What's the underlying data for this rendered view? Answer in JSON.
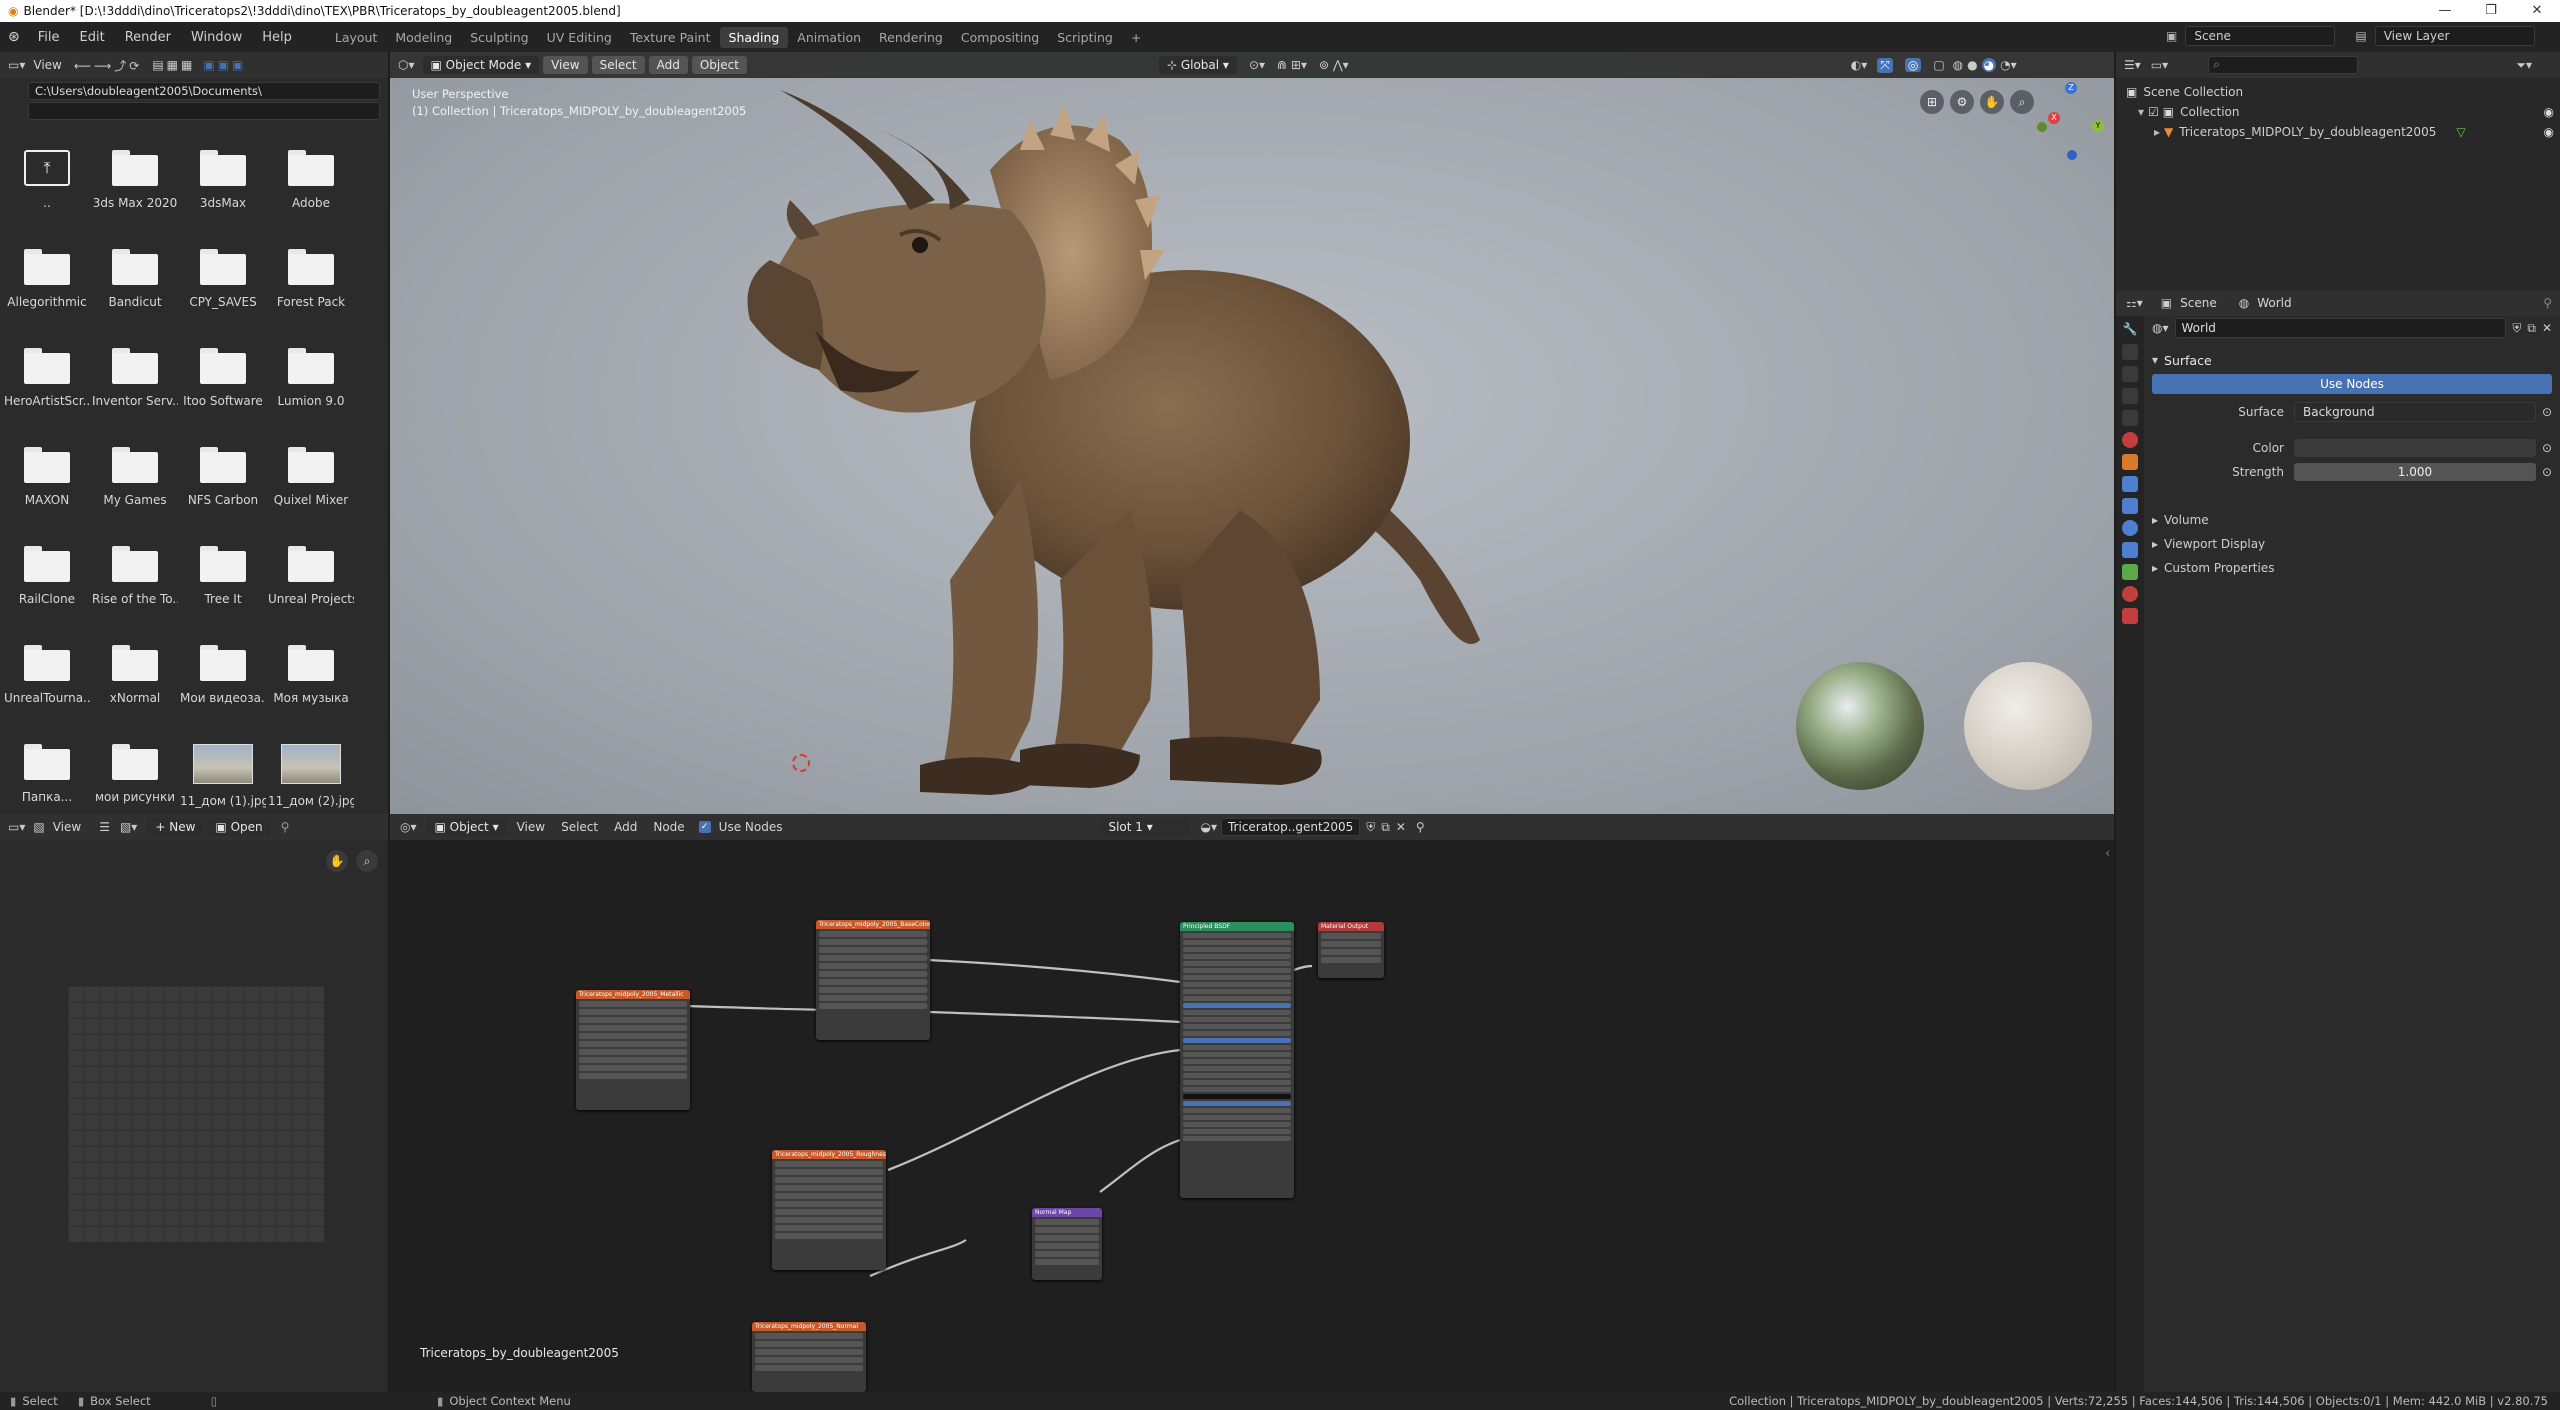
{
  "window": {
    "title": "Blender* [D:\\!3dddi\\dino\\Triceratops2\\!3dddi\\dino\\TEX\\PBR\\Triceratops_by_doubleagent2005.blend]",
    "min": "—",
    "max": "❐",
    "close": "✕"
  },
  "menu": {
    "items": [
      "File",
      "Edit",
      "Render",
      "Window",
      "Help"
    ]
  },
  "workspaces": {
    "tabs": [
      "Layout",
      "Modeling",
      "Sculpting",
      "UV Editing",
      "Texture Paint",
      "Shading",
      "Animation",
      "Rendering",
      "Compositing",
      "Scripting"
    ],
    "active": "Shading",
    "add": "+"
  },
  "scene": {
    "label": "Scene",
    "view_layer": "View Layer"
  },
  "filebrowser": {
    "view": "View",
    "path": "C:\\Users\\doubleagent2005\\Documents\\",
    "items": [
      {
        "label": ".."
      },
      {
        "label": "3ds Max 2020"
      },
      {
        "label": "3dsMax"
      },
      {
        "label": "Adobe"
      },
      {
        "label": "Allegorithmic"
      },
      {
        "label": "Bandicut"
      },
      {
        "label": "CPY_SAVES"
      },
      {
        "label": "Forest Pack"
      },
      {
        "label": "HeroArtistScr..."
      },
      {
        "label": "Inventor Serv..."
      },
      {
        "label": "Itoo Software"
      },
      {
        "label": "Lumion 9.0"
      },
      {
        "label": "MAXON"
      },
      {
        "label": "My Games"
      },
      {
        "label": "NFS Carbon"
      },
      {
        "label": "Quixel Mixer"
      },
      {
        "label": "RailClone"
      },
      {
        "label": "Rise of the To..."
      },
      {
        "label": "Tree It"
      },
      {
        "label": "Unreal Projects"
      },
      {
        "label": "UnrealTourna..."
      },
      {
        "label": "xNormal"
      },
      {
        "label": "Мои видеоза..."
      },
      {
        "label": "Моя музыка"
      },
      {
        "label": "Папка..."
      },
      {
        "label": "мои рисунки"
      },
      {
        "label": "11_дом (1).jpg"
      },
      {
        "label": "11_дом (2).jpg"
      }
    ]
  },
  "viewport": {
    "mode": "Object Mode",
    "menus": [
      "View",
      "Select",
      "Add",
      "Object"
    ],
    "orientation": "Global",
    "info_line1": "User Perspective",
    "info_line2": "(1) Collection | Triceratops_MIDPOLY_by_doubleagent2005",
    "gizmo": {
      "x": "X",
      "y": "Y",
      "z": "Z"
    }
  },
  "outliner": {
    "search_placeholder": "",
    "root": "Scene Collection",
    "collection": "Collection",
    "object": "Triceratops_MIDPOLY_by_doubleagent2005"
  },
  "properties": {
    "tab_scene": "Scene",
    "tab_world": "World",
    "world_name": "World",
    "surface_panel": "Surface",
    "use_nodes": "Use Nodes",
    "surface_label": "Surface",
    "surface_value": "Background",
    "color_label": "Color",
    "strength_label": "Strength",
    "strength_value": "1.000",
    "panels": [
      "Volume",
      "Viewport Display",
      "Custom Properties"
    ]
  },
  "image_editor": {
    "view": "View",
    "new": "New",
    "open": "Open"
  },
  "node_editor": {
    "object": "Object",
    "menus": [
      "View",
      "Select",
      "Add",
      "Node"
    ],
    "use_nodes": "Use Nodes",
    "slot": "Slot 1",
    "material": "Triceratop..gent2005",
    "footer_name": "Triceratops_by_doubleagent2005",
    "nodes": {
      "basecolor": "Triceratops_midpoly_2005_BaseColor",
      "metallic": "Triceratops_midpoly_2005_Metallic",
      "roughness": "Triceratops_midpoly_2005_Roughness",
      "normal": "Triceratops_midpoly_2005_Normal",
      "normalmap": "Normal Map",
      "bsdf": "Principled BSDF",
      "output": "Material Output"
    }
  },
  "status": {
    "select": "Select",
    "box_select": "Box Select",
    "context": "Object Context Menu",
    "right": "Collection | Triceratops_MIDPOLY_by_doubleagent2005 | Verts:72,255 | Faces:144,506 | Tris:144,506 | Objects:0/1 | Mem: 442.0 MiB | v2.80.75"
  },
  "colors": {
    "accent": "#4772b3",
    "tex_node": "#c65a2a",
    "bsdf_node": "#2a8f5a",
    "vector_node": "#6c47a8",
    "output_node": "#b23a3a"
  }
}
